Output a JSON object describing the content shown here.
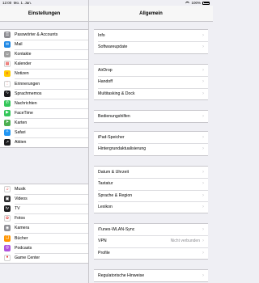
{
  "status": {
    "time": "12:00",
    "date": "Mo. 1. Jan.",
    "battery": "100%"
  },
  "left": {
    "title": "Einstellungen",
    "group1": [
      {
        "label": "Passwörter & Accounts",
        "icon": "key-icon",
        "color": "#8e8e93",
        "glyph": "⚿"
      },
      {
        "label": "Mail",
        "icon": "mail-icon",
        "color": "#1e88e5",
        "glyph": "✉"
      },
      {
        "label": "Kontakte",
        "icon": "contacts-icon",
        "color": "#9e9e9e",
        "glyph": "☺"
      },
      {
        "label": "Kalender",
        "icon": "calendar-icon",
        "color": "#ffffff",
        "glyph": "▦"
      },
      {
        "label": "Notizen",
        "icon": "notes-icon",
        "color": "#ffcc00",
        "glyph": "≡"
      },
      {
        "label": "Erinnerungen",
        "icon": "reminders-icon",
        "color": "#ffffff",
        "glyph": "⋮"
      },
      {
        "label": "Sprachmemos",
        "icon": "voice-memos-icon",
        "color": "#1c1c1e",
        "glyph": "∿"
      },
      {
        "label": "Nachrichten",
        "icon": "messages-icon",
        "color": "#34c759",
        "glyph": "✆"
      },
      {
        "label": "FaceTime",
        "icon": "facetime-icon",
        "color": "#34c759",
        "glyph": "▶"
      },
      {
        "label": "Karten",
        "icon": "maps-icon",
        "color": "#4caf50",
        "glyph": "➤"
      },
      {
        "label": "Safari",
        "icon": "safari-icon",
        "color": "#2196f3",
        "glyph": "✧"
      },
      {
        "label": "Aktien",
        "icon": "stocks-icon",
        "color": "#1c1c1e",
        "glyph": "↗"
      }
    ],
    "group2": [
      {
        "label": "Musik",
        "icon": "music-icon",
        "color": "#ffffff",
        "glyph": "♫"
      },
      {
        "label": "Videos",
        "icon": "videos-icon",
        "color": "#2c2c2e",
        "glyph": "▣"
      },
      {
        "label": "TV",
        "icon": "tv-icon",
        "color": "#1c1c1e",
        "glyph": "tv"
      },
      {
        "label": "Fotos",
        "icon": "photos-icon",
        "color": "#ffffff",
        "glyph": "✿"
      },
      {
        "label": "Kamera",
        "icon": "camera-icon",
        "color": "#8e8e93",
        "glyph": "◉"
      },
      {
        "label": "Bücher",
        "icon": "books-icon",
        "color": "#ff9500",
        "glyph": "❏"
      },
      {
        "label": "Podcasts",
        "icon": "podcasts-icon",
        "color": "#af52de",
        "glyph": "◎"
      },
      {
        "label": "Game Center",
        "icon": "game-center-icon",
        "color": "#ffffff",
        "glyph": "●"
      }
    ]
  },
  "right": {
    "title": "Allgemein",
    "groups": [
      [
        {
          "label": "Info",
          "value": ""
        },
        {
          "label": "Softwareupdate",
          "value": ""
        }
      ],
      [
        {
          "label": "AirDrop",
          "value": ""
        },
        {
          "label": "Handoff",
          "value": ""
        },
        {
          "label": "Multitasking & Dock",
          "value": ""
        }
      ],
      [
        {
          "label": "Bedienungshilfen",
          "value": ""
        }
      ],
      [
        {
          "label": "iPad-Speicher",
          "value": ""
        },
        {
          "label": "Hintergrundaktualisierung",
          "value": ""
        }
      ],
      [
        {
          "label": "Datum & Uhrzeit",
          "value": ""
        },
        {
          "label": "Tastatur",
          "value": ""
        },
        {
          "label": "Sprache & Region",
          "value": ""
        },
        {
          "label": "Lexikon",
          "value": ""
        }
      ],
      [
        {
          "label": "iTunes-WLAN-Sync",
          "value": ""
        },
        {
          "label": "VPN",
          "value": "Nicht verbunden"
        },
        {
          "label": "Profile",
          "value": ""
        }
      ],
      [
        {
          "label": "Regulatorische Hinweise",
          "value": ""
        }
      ]
    ]
  }
}
